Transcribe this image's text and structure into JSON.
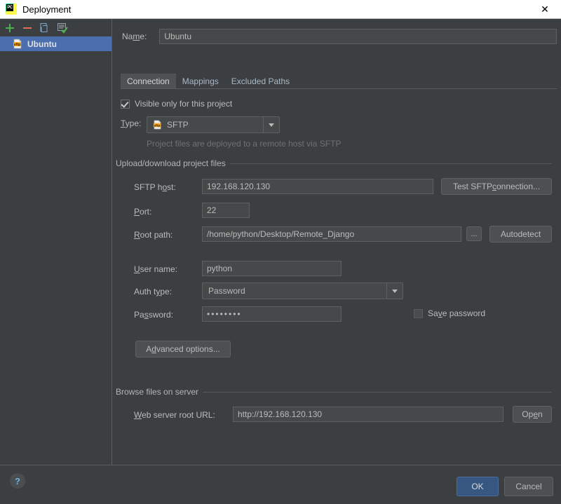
{
  "window": {
    "title": "Deployment",
    "app_icon": "pycharm-icon",
    "close_label": "✕"
  },
  "sidebar": {
    "toolbar": [
      {
        "name": "add-icon",
        "label": "+",
        "color": "#4caf50"
      },
      {
        "name": "remove-icon",
        "label": "−",
        "color": "#e06c5a"
      },
      {
        "name": "copy-icon",
        "label": "copy",
        "color": "#6aa0d8"
      },
      {
        "name": "set-default-icon",
        "label": "set-default",
        "color": "#5fb85f"
      }
    ],
    "items": [
      {
        "label": "Ubuntu",
        "icon": "sftp-icon",
        "selected": true
      }
    ]
  },
  "form": {
    "name_label": "Name:",
    "name_label_pre": "Na",
    "name_label_mnemonic": "m",
    "name_label_post": "e:",
    "name_value": "Ubuntu"
  },
  "tabs": [
    {
      "label": "Connection",
      "active": true
    },
    {
      "label": "Mappings",
      "active": false
    },
    {
      "label": "Excluded Paths",
      "active": false
    }
  ],
  "connection": {
    "visible_only_checkbox": {
      "label": "Visible only for this project",
      "checked": true
    },
    "type_label": "Type:",
    "type_label_pre": "",
    "type_label_mnemonic": "T",
    "type_label_post": "ype:",
    "type_value": "SFTP",
    "type_icon": "sftp-icon",
    "type_hint": "Project files are deployed to a remote host via SFTP",
    "group_upload": "Upload/download project files",
    "sftp_host_label_pre": "SFTP h",
    "sftp_host_label_mnemonic": "o",
    "sftp_host_label_post": "st:",
    "sftp_host_value": "192.168.120.130",
    "test_connection_btn_pre": "Test SFTP ",
    "test_connection_btn_mnemonic": "c",
    "test_connection_btn_post": "onnection...",
    "port_label_pre": "",
    "port_label_mnemonic": "P",
    "port_label_post": "ort:",
    "port_value": "22",
    "root_path_label_pre": "",
    "root_path_label_mnemonic": "R",
    "root_path_label_post": "oot path:",
    "root_path_value": "/home/python/Desktop/Remote_Django",
    "browse_btn": "...",
    "autodetect_btn": "Autodetect",
    "user_name_label_pre": "",
    "user_name_label_mnemonic": "U",
    "user_name_label_post": "ser name:",
    "user_name_value": "python",
    "auth_type_label_pre": "Auth t",
    "auth_type_label_mnemonic": "y",
    "auth_type_label_post": "pe:",
    "auth_type_value": "Password",
    "password_label_pre": "Pa",
    "password_label_mnemonic": "s",
    "password_label_post": "sword:",
    "password_value": "••••••••",
    "save_password_checkbox": {
      "label_pre": "Sa",
      "label_mnemonic": "v",
      "label_post": "e password",
      "checked": false
    },
    "advanced_btn_pre": "A",
    "advanced_btn_mnemonic": "d",
    "advanced_btn_post": "vanced options...",
    "group_browse": "Browse files on server",
    "web_url_label_pre": "",
    "web_url_label_mnemonic": "W",
    "web_url_label_post": "eb server root URL:",
    "web_url_value": "http://192.168.120.130",
    "open_btn_pre": "Op",
    "open_btn_mnemonic": "e",
    "open_btn_post": "n"
  },
  "footer": {
    "help_label": "?",
    "ok_label": "OK",
    "cancel_label": "Cancel"
  },
  "colors": {
    "background": "#3c3f41",
    "selection": "#4b6eaf",
    "field": "#45494a",
    "accent_ok": "#365880",
    "text": "#bbbbbb",
    "hint": "#6e7173"
  }
}
